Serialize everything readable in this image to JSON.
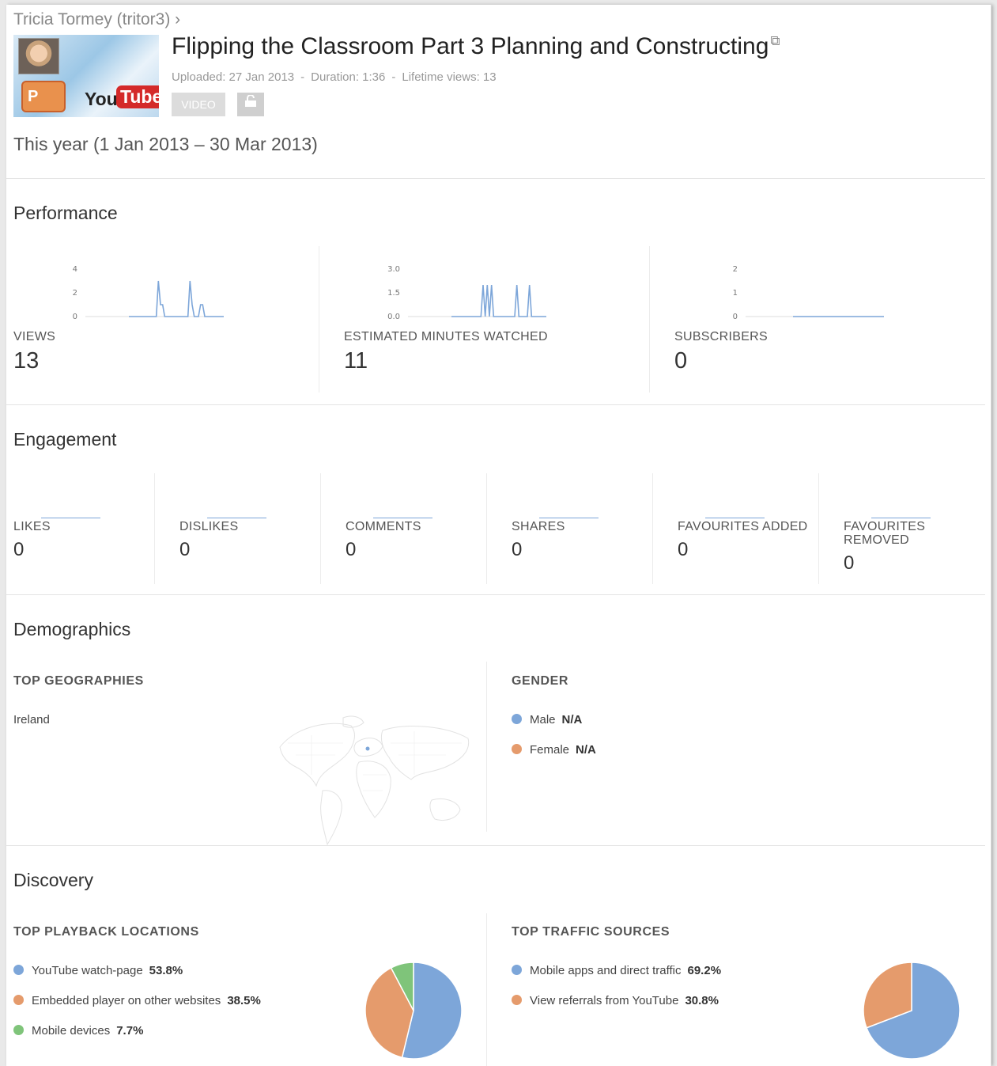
{
  "colors": {
    "series_blue": "#7da6d9",
    "series_orange": "#e59b6c",
    "series_green": "#7fc47a"
  },
  "header": {
    "breadcrumb": "Tricia Tormey (tritor3) ›",
    "title": "Flipping the Classroom Part 3 Planning and Constructing",
    "uploaded": "Uploaded: 27 Jan 2013",
    "duration": "Duration: 1:36",
    "lifetime_views": "Lifetime views: 13",
    "meta_separator": "-",
    "video_tag": "VIDEO",
    "thumbnail": {
      "ppt_text": "P",
      "yt_you": "You",
      "yt_tube": "Tube"
    },
    "date_range": "This year (1 Jan 2013 – 30 Mar 2013)"
  },
  "performance": {
    "title": "Performance",
    "metrics": [
      {
        "label": "VIEWS",
        "value": "13",
        "ticks": [
          "4",
          "2",
          "0"
        ]
      },
      {
        "label": "ESTIMATED MINUTES WATCHED",
        "value": "11",
        "ticks": [
          "3.0",
          "1.5",
          "0.0"
        ]
      },
      {
        "label": "SUBSCRIBERS",
        "value": "0",
        "ticks": [
          "2",
          "1",
          "0"
        ]
      }
    ]
  },
  "engagement": {
    "title": "Engagement",
    "metrics": [
      {
        "label": "LIKES",
        "value": "0"
      },
      {
        "label": "DISLIKES",
        "value": "0"
      },
      {
        "label": "COMMENTS",
        "value": "0"
      },
      {
        "label": "SHARES",
        "value": "0"
      },
      {
        "label": "FAVOURITES ADDED",
        "value": "0"
      },
      {
        "label": "FAVOURITES REMOVED",
        "value": "0"
      }
    ]
  },
  "demographics": {
    "title": "Demographics",
    "geo_title": "TOP GEOGRAPHIES",
    "geo_items": [
      "Ireland"
    ],
    "gender_title": "GENDER",
    "gender": [
      {
        "label": "Male",
        "value": "N/A"
      },
      {
        "label": "Female",
        "value": "N/A"
      }
    ]
  },
  "discovery": {
    "title": "Discovery",
    "playback_title": "TOP PLAYBACK LOCATIONS",
    "playback": [
      {
        "label": "YouTube watch-page",
        "value": "53.8%"
      },
      {
        "label": "Embedded player on other websites",
        "value": "38.5%"
      },
      {
        "label": "Mobile devices",
        "value": "7.7%"
      }
    ],
    "traffic_title": "TOP TRAFFIC SOURCES",
    "traffic": [
      {
        "label": "Mobile apps and direct traffic",
        "value": "69.2%"
      },
      {
        "label": "View referrals from YouTube",
        "value": "30.8%"
      }
    ]
  },
  "chart_data": [
    {
      "type": "line",
      "name": "views-sparkline",
      "ylim": [
        0,
        4
      ],
      "ticks": [
        0,
        2,
        4
      ],
      "values": [
        0,
        0,
        0,
        0,
        0,
        0,
        0,
        0,
        0,
        0,
        0,
        0,
        0,
        0,
        3,
        1,
        1,
        0,
        0,
        0,
        0,
        0,
        0,
        0,
        0,
        0,
        0,
        0,
        0,
        3,
        1,
        0,
        0,
        0,
        1,
        1,
        0,
        0,
        0,
        0,
        0,
        0,
        0,
        0,
        0,
        0
      ]
    },
    {
      "type": "line",
      "name": "minutes-sparkline",
      "ylim": [
        0,
        3.0
      ],
      "ticks": [
        0.0,
        1.5,
        3.0
      ],
      "values": [
        0,
        0,
        0,
        0,
        0,
        0,
        0,
        0,
        0,
        0,
        0,
        0,
        0,
        0,
        0,
        2,
        0,
        2,
        0,
        2,
        0,
        0,
        0,
        0,
        0,
        0,
        0,
        0,
        0,
        0,
        0,
        2,
        0,
        0,
        0,
        0,
        0,
        2,
        0,
        0,
        0,
        0,
        0,
        0,
        0,
        0
      ]
    },
    {
      "type": "line",
      "name": "subscribers-sparkline",
      "ylim": [
        0,
        2
      ],
      "ticks": [
        0,
        1,
        2
      ],
      "values": [
        0,
        0,
        0,
        0,
        0,
        0,
        0,
        0,
        0,
        0,
        0,
        0,
        0,
        0,
        0,
        0,
        0,
        0,
        0,
        0,
        0,
        0,
        0,
        0,
        0,
        0,
        0,
        0,
        0,
        0,
        0,
        0,
        0,
        0,
        0,
        0,
        0,
        0,
        0,
        0
      ]
    },
    {
      "type": "pie",
      "name": "playback-locations",
      "categories": [
        "YouTube watch-page",
        "Embedded player on other websites",
        "Mobile devices"
      ],
      "values": [
        53.8,
        38.5,
        7.7
      ]
    },
    {
      "type": "pie",
      "name": "traffic-sources",
      "categories": [
        "Mobile apps and direct traffic",
        "View referrals from YouTube"
      ],
      "values": [
        69.2,
        30.8
      ]
    }
  ]
}
